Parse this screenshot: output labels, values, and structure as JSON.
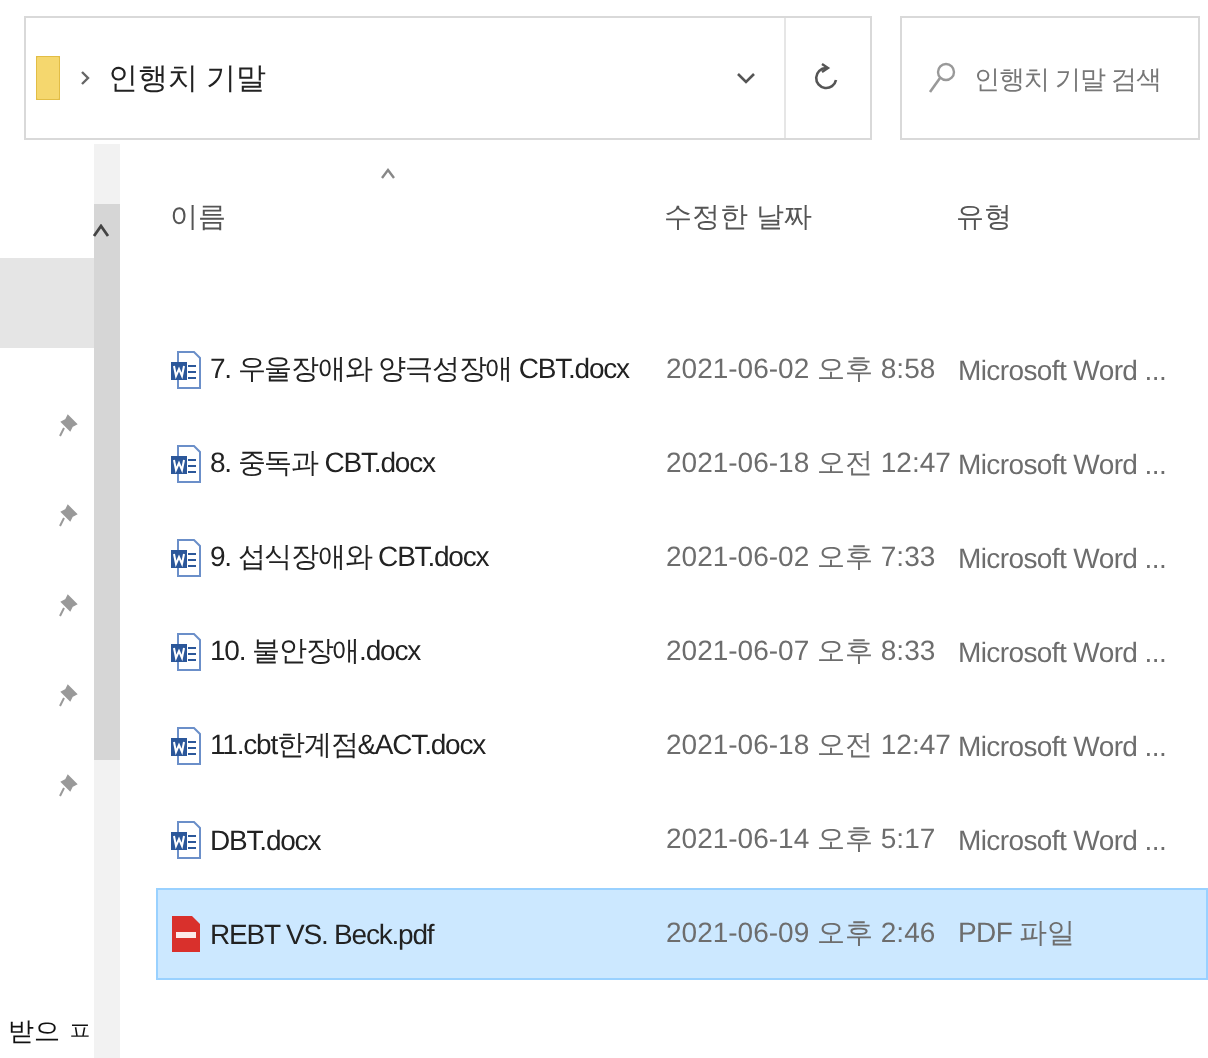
{
  "address_bar": {
    "path": "인행치 기말"
  },
  "search": {
    "placeholder": "인행치 기말 검색"
  },
  "nav_pane": {
    "items": [
      {
        "selected": true,
        "pinned": false
      },
      {
        "selected": false,
        "pinned": true
      },
      {
        "selected": false,
        "pinned": true
      },
      {
        "selected": false,
        "pinned": true
      },
      {
        "selected": false,
        "pinned": true
      },
      {
        "selected": false,
        "pinned": true
      }
    ],
    "footer_label": "받으 ㅍ"
  },
  "columns": [
    {
      "label": "이름",
      "sorted": true
    },
    {
      "label": "수정한 날짜",
      "sorted": false
    },
    {
      "label": "유형",
      "sorted": false
    }
  ],
  "rows": [
    {
      "kind": "word",
      "name": "7. 우울장애와 양극성장애 CBT.docx",
      "modified": "2021-06-02 오후 8:58",
      "type": "Microsoft Word ...",
      "selected": false
    },
    {
      "kind": "word",
      "name": "8. 중독과 CBT.docx",
      "modified": "2021-06-18 오전 12:47",
      "type": "Microsoft Word ...",
      "selected": false
    },
    {
      "kind": "word",
      "name": "9. 섭식장애와 CBT.docx",
      "modified": "2021-06-02 오후 7:33",
      "type": "Microsoft Word ...",
      "selected": false
    },
    {
      "kind": "word",
      "name": "10. 불안장애.docx",
      "modified": "2021-06-07 오후 8:33",
      "type": "Microsoft Word ...",
      "selected": false
    },
    {
      "kind": "word",
      "name": "11.cbt한계점&ACT.docx",
      "modified": "2021-06-18 오전 12:47",
      "type": "Microsoft Word ...",
      "selected": false
    },
    {
      "kind": "word",
      "name": "DBT.docx",
      "modified": "2021-06-14 오후 5:17",
      "type": "Microsoft Word ...",
      "selected": false
    },
    {
      "kind": "pdf",
      "name": "REBT VS. Beck.pdf",
      "modified": "2021-06-09 오후 2:46",
      "type": "PDF 파일",
      "selected": true
    }
  ]
}
